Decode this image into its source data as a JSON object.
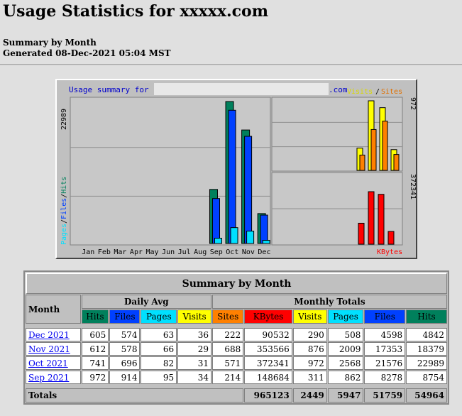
{
  "header": {
    "title": "Usage Statistics for xxxxx.com",
    "summary_line": "Summary by Month",
    "generated_line": "Generated 08-Dec-2021 05:04 MST"
  },
  "chart": {
    "title_left": "Usage summary for",
    "title_right": ".com",
    "legend_visits": "Visits",
    "legend_slash": "/",
    "legend_sites": "Sites",
    "legend_kbytes": "KBytes",
    "y_label_pages": "Pages",
    "y_label_files": "Files",
    "y_label_hits": "Hits",
    "y_label_sep": "/",
    "left_max_label": "22989",
    "right_top_max_label": "972",
    "right_bottom_max_label": "372341",
    "colors": {
      "hits": "#00805c",
      "files": "#0040ff",
      "pages": "#00e0ff",
      "visits": "#ffff00",
      "sites": "#ff8000",
      "kbytes": "#ff0000"
    }
  },
  "chart_data": {
    "type": "bar",
    "categories": [
      "Jan",
      "Feb",
      "Mar",
      "Apr",
      "May",
      "Jun",
      "Jul",
      "Aug",
      "Sep",
      "Oct",
      "Nov",
      "Dec"
    ],
    "series": [
      {
        "name": "Hits",
        "values": [
          0,
          0,
          0,
          0,
          0,
          0,
          0,
          0,
          8754,
          22989,
          18379,
          4842
        ]
      },
      {
        "name": "Files",
        "values": [
          0,
          0,
          0,
          0,
          0,
          0,
          0,
          0,
          7278,
          21576,
          17353,
          4598
        ]
      },
      {
        "name": "Pages",
        "values": [
          0,
          0,
          0,
          0,
          0,
          0,
          0,
          0,
          862,
          2568,
          2009,
          508
        ]
      },
      {
        "name": "Visits",
        "values": [
          0,
          0,
          0,
          0,
          0,
          0,
          0,
          0,
          311,
          972,
          876,
          290
        ]
      },
      {
        "name": "Sites",
        "values": [
          0,
          0,
          0,
          0,
          0,
          0,
          0,
          0,
          214,
          571,
          688,
          222
        ]
      },
      {
        "name": "KBytes",
        "values": [
          0,
          0,
          0,
          0,
          0,
          0,
          0,
          0,
          148684,
          372341,
          353566,
          90532
        ]
      }
    ],
    "ylim_hits": [
      0,
      22989
    ],
    "ylim_visits": [
      0,
      972
    ],
    "ylim_kbytes": [
      0,
      372341
    ],
    "grid": true
  },
  "table": {
    "caption": "Summary by Month",
    "month_header": "Month",
    "daily_avg_header": "Daily Avg",
    "monthly_totals_header": "Monthly Totals",
    "col_hits": "Hits",
    "col_files": "Files",
    "col_pages": "Pages",
    "col_visits": "Visits",
    "col_sites": "Sites",
    "col_kbytes": "KBytes",
    "rows": [
      {
        "month": "Dec 2021",
        "d_hits": "605",
        "d_files": "574",
        "d_pages": "63",
        "d_visits": "36",
        "sites": "222",
        "kbytes": "90532",
        "visits": "290",
        "pages": "508",
        "files": "4598",
        "hits": "4842"
      },
      {
        "month": "Nov 2021",
        "d_hits": "612",
        "d_files": "578",
        "d_pages": "66",
        "d_visits": "29",
        "sites": "688",
        "kbytes": "353566",
        "visits": "876",
        "pages": "2009",
        "files": "17353",
        "hits": "18379"
      },
      {
        "month": "Oct 2021",
        "d_hits": "741",
        "d_files": "696",
        "d_pages": "82",
        "d_visits": "31",
        "sites": "571",
        "kbytes": "372341",
        "visits": "972",
        "pages": "2568",
        "files": "21576",
        "hits": "22989"
      },
      {
        "month": "Sep 2021",
        "d_hits": "972",
        "d_files": "914",
        "d_pages": "95",
        "d_visits": "34",
        "sites": "214",
        "kbytes": "148684",
        "visits": "311",
        "pages": "862",
        "files": "8278",
        "hits": "8754"
      }
    ],
    "totals_label": "Totals",
    "totals": {
      "kbytes": "965123",
      "visits": "2449",
      "pages": "5947",
      "files": "51759",
      "hits": "54964"
    }
  }
}
